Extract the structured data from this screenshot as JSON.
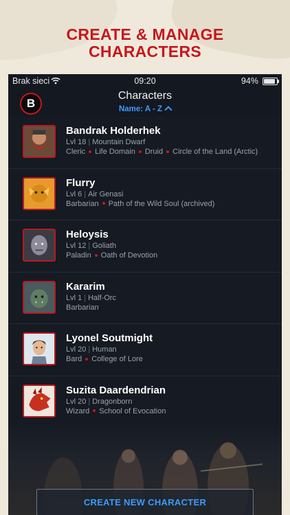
{
  "promo": {
    "headline_line1": "CREATE & MANAGE",
    "headline_line2": "CHARACTERS"
  },
  "status_bar": {
    "carrier": "Brak sieci",
    "time": "09:20",
    "battery": "94%"
  },
  "nav": {
    "logo_letter": "B",
    "title": "Characters",
    "sort_label": "Name: A - Z"
  },
  "characters": [
    {
      "name": "Bandrak Holderhek",
      "level": "Lvl 18",
      "race": "Mountain Dwarf",
      "classes": [
        "Cleric",
        "Life Domain",
        "Druid",
        "Circle of the Land (Arctic)"
      ],
      "avatar": "dwarf-portrait"
    },
    {
      "name": "Flurry",
      "level": "Lvl 6",
      "race": "Air Genasi",
      "classes": [
        "Barbarian",
        "Path of the Wild Soul (archived)"
      ],
      "avatar": "genasi-portrait"
    },
    {
      "name": "Heloysis",
      "level": "Lvl 12",
      "race": "Goliath",
      "classes": [
        "Paladin",
        "Oath of Devotion"
      ],
      "avatar": "goliath-portrait"
    },
    {
      "name": "Kararim",
      "level": "Lvl 1",
      "race": "Half-Orc",
      "classes": [
        "Barbarian"
      ],
      "avatar": "orc-portrait"
    },
    {
      "name": "Lyonel Soutmight",
      "level": "Lvl 20",
      "race": "Human",
      "classes": [
        "Bard",
        "College of Lore"
      ],
      "avatar": "human-portrait"
    },
    {
      "name": "Suzita Daardendrian",
      "level": "Lvl 20",
      "race": "Dragonborn",
      "classes": [
        "Wizard",
        "School of Evocation"
      ],
      "avatar": "dragonborn-portrait"
    }
  ],
  "create_button": "CREATE NEW CHARACTER"
}
